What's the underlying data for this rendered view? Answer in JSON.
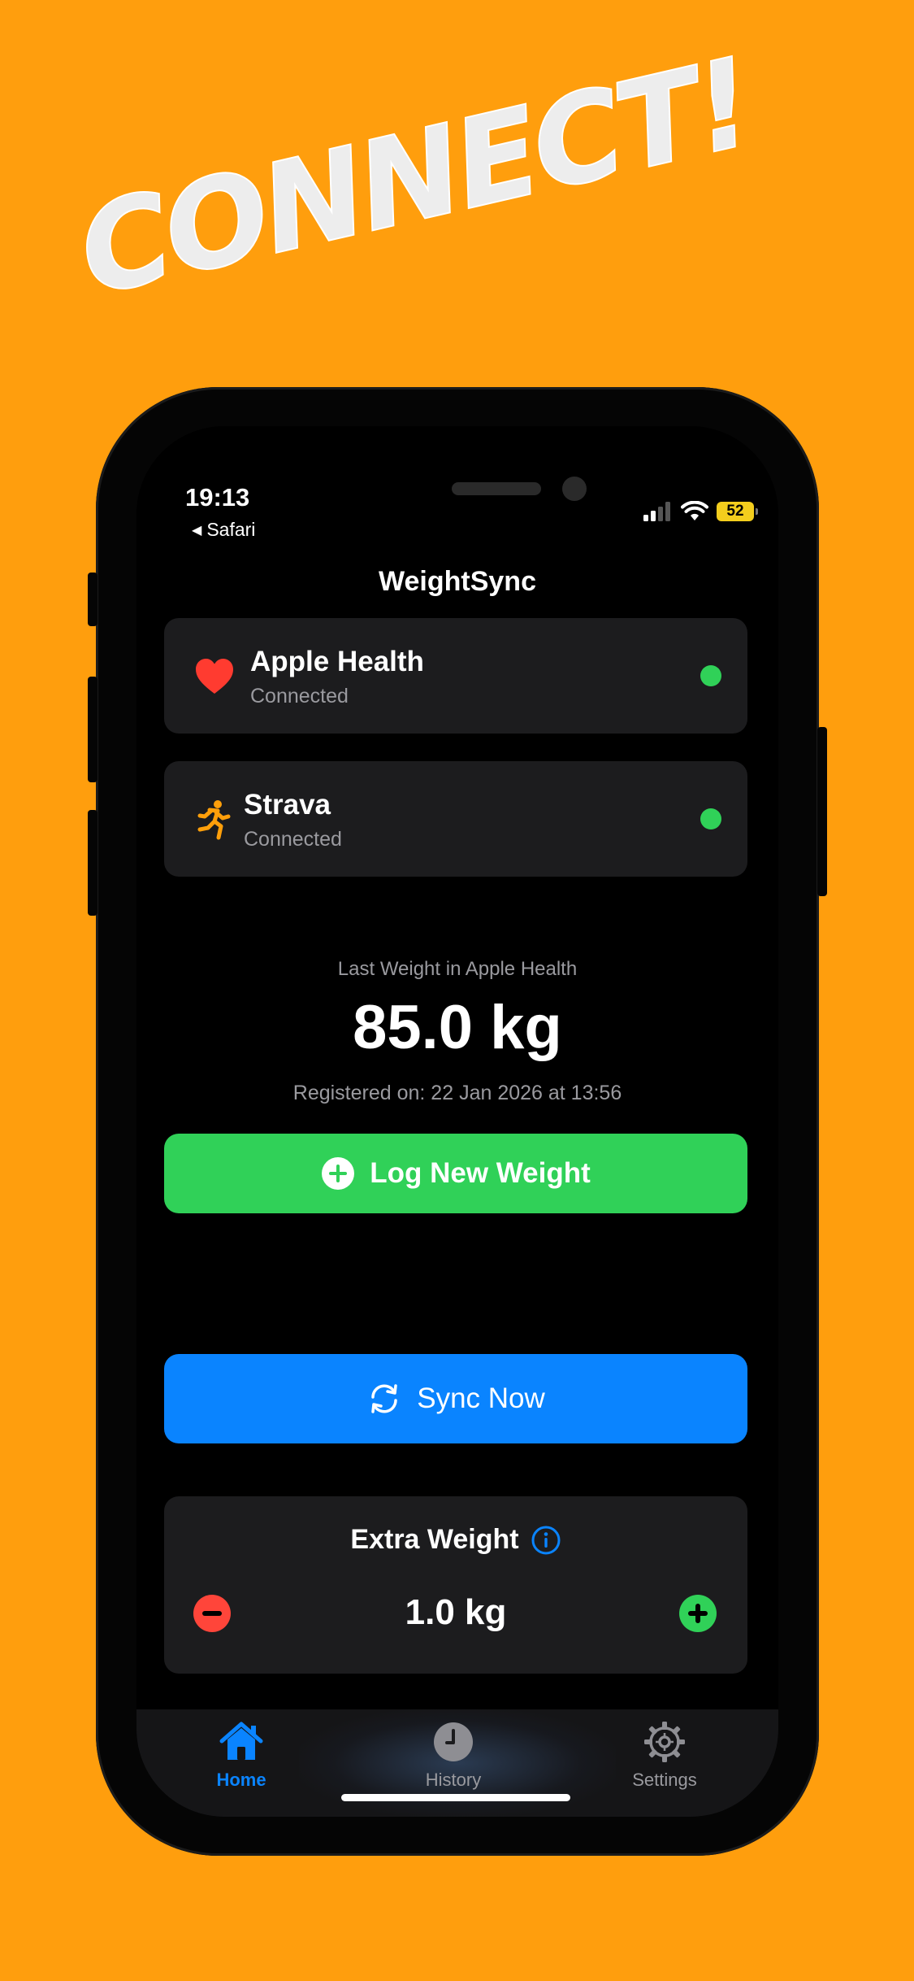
{
  "headline": "CONNECT!",
  "status_bar": {
    "time": "19:13",
    "back_app": "Safari",
    "battery": "52"
  },
  "app_title": "WeightSync",
  "services": [
    {
      "name": "Apple Health",
      "status": "Connected",
      "icon": "heart-icon",
      "icon_color": "#FF3B30"
    },
    {
      "name": "Strava",
      "status": "Connected",
      "icon": "runner-icon",
      "icon_color": "#FF9F0A"
    }
  ],
  "last_weight": {
    "label": "Last Weight in Apple Health",
    "value": "85.0 kg",
    "registered": "Registered on: 22 Jan 2026 at 13:56"
  },
  "actions": {
    "log_label": "Log New Weight",
    "sync_label": "Sync Now"
  },
  "extra_weight": {
    "title": "Extra Weight",
    "value": "1.0 kg"
  },
  "tabs": [
    {
      "label": "Home",
      "icon": "house-icon",
      "active": true
    },
    {
      "label": "History",
      "icon": "clock-icon",
      "active": false
    },
    {
      "label": "Settings",
      "icon": "gear-icon",
      "active": false
    }
  ],
  "colors": {
    "background": "#FF9E0D",
    "green": "#30D158",
    "blue": "#0A84FF",
    "red": "#FF453A",
    "card": "#1C1C1E"
  }
}
